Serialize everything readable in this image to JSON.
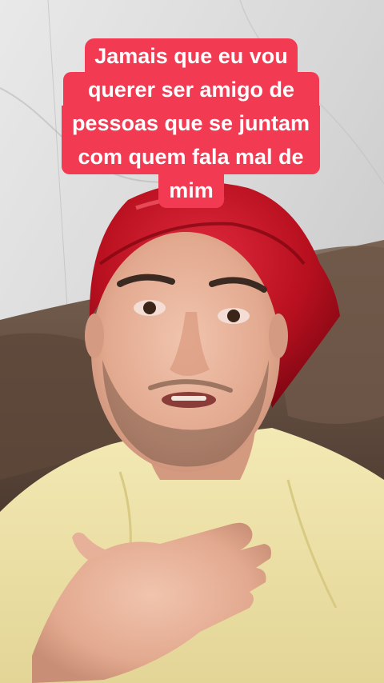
{
  "video": {
    "caption_lines": [
      "Jamais que eu vou",
      "querer ser amigo de",
      "pessoas que se juntam",
      "com quem fala mal de",
      "mim"
    ]
  },
  "colors": {
    "caption_bg": "#f23b52",
    "caption_text": "#ffffff",
    "bonnet": "#c4142a",
    "shirt": "#efe3a6",
    "sofa": "#6b5446",
    "wall": "#d9d9d9"
  }
}
